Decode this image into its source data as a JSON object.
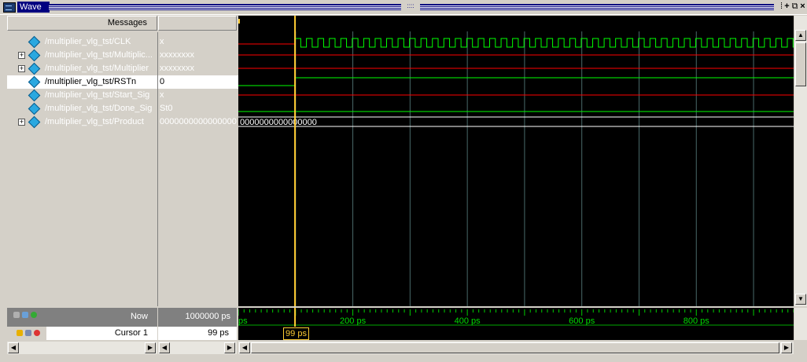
{
  "window": {
    "title": "Wave"
  },
  "headers": {
    "messages": "Messages"
  },
  "signals": [
    {
      "name": "/multiplier_vlg_tst/CLK",
      "value": "x",
      "expandable": false,
      "selected": false
    },
    {
      "name": "/multiplier_vlg_tst/Multiplic...",
      "value": "xxxxxxxx",
      "expandable": true,
      "selected": false
    },
    {
      "name": "/multiplier_vlg_tst/Multiplier",
      "value": "xxxxxxxx",
      "expandable": true,
      "selected": false
    },
    {
      "name": "/multiplier_vlg_tst/RSTn",
      "value": "0",
      "expandable": false,
      "selected": true
    },
    {
      "name": "/multiplier_vlg_tst/Start_Sig",
      "value": "x",
      "expandable": false,
      "selected": false
    },
    {
      "name": "/multiplier_vlg_tst/Done_Sig",
      "value": "St0",
      "expandable": false,
      "selected": false
    },
    {
      "name": "/multiplier_vlg_tst/Product",
      "value": "0000000000000000",
      "expandable": true,
      "selected": false
    }
  ],
  "wave": {
    "product_label": "0000000000000000",
    "cursor_time_ps": 99,
    "view_start_ps": 0,
    "view_end_ps": 970,
    "clock_period_ps": 20,
    "colors": {
      "clk": "#00ff00",
      "undefined": "#ff0000",
      "low": "#00ff00",
      "grid": "#4a6a6a",
      "cursor": "#ffcc33"
    }
  },
  "status": {
    "now_label": "Now",
    "now_value": "1000000 ps",
    "cursor_label": "Cursor 1",
    "cursor_value": "99 ps",
    "cursor_flag": "99 ps"
  },
  "ruler": {
    "ticks": [
      {
        "t": 0,
        "label": "ps"
      },
      {
        "t": 200,
        "label": "200 ps"
      },
      {
        "t": 400,
        "label": "400 ps"
      },
      {
        "t": 600,
        "label": "600 ps"
      },
      {
        "t": 800,
        "label": "800 ps"
      }
    ]
  }
}
